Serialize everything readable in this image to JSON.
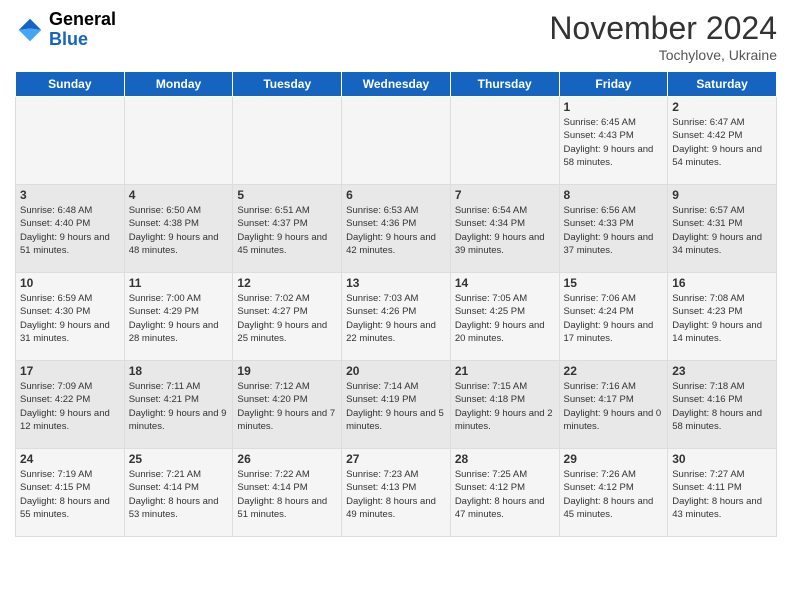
{
  "header": {
    "logo_general": "General",
    "logo_blue": "Blue",
    "month_title": "November 2024",
    "subtitle": "Tochylove, Ukraine"
  },
  "days_of_week": [
    "Sunday",
    "Monday",
    "Tuesday",
    "Wednesday",
    "Thursday",
    "Friday",
    "Saturday"
  ],
  "weeks": [
    [
      {
        "day": "",
        "info": ""
      },
      {
        "day": "",
        "info": ""
      },
      {
        "day": "",
        "info": ""
      },
      {
        "day": "",
        "info": ""
      },
      {
        "day": "",
        "info": ""
      },
      {
        "day": "1",
        "info": "Sunrise: 6:45 AM\nSunset: 4:43 PM\nDaylight: 9 hours and 58 minutes."
      },
      {
        "day": "2",
        "info": "Sunrise: 6:47 AM\nSunset: 4:42 PM\nDaylight: 9 hours and 54 minutes."
      }
    ],
    [
      {
        "day": "3",
        "info": "Sunrise: 6:48 AM\nSunset: 4:40 PM\nDaylight: 9 hours and 51 minutes."
      },
      {
        "day": "4",
        "info": "Sunrise: 6:50 AM\nSunset: 4:38 PM\nDaylight: 9 hours and 48 minutes."
      },
      {
        "day": "5",
        "info": "Sunrise: 6:51 AM\nSunset: 4:37 PM\nDaylight: 9 hours and 45 minutes."
      },
      {
        "day": "6",
        "info": "Sunrise: 6:53 AM\nSunset: 4:36 PM\nDaylight: 9 hours and 42 minutes."
      },
      {
        "day": "7",
        "info": "Sunrise: 6:54 AM\nSunset: 4:34 PM\nDaylight: 9 hours and 39 minutes."
      },
      {
        "day": "8",
        "info": "Sunrise: 6:56 AM\nSunset: 4:33 PM\nDaylight: 9 hours and 37 minutes."
      },
      {
        "day": "9",
        "info": "Sunrise: 6:57 AM\nSunset: 4:31 PM\nDaylight: 9 hours and 34 minutes."
      }
    ],
    [
      {
        "day": "10",
        "info": "Sunrise: 6:59 AM\nSunset: 4:30 PM\nDaylight: 9 hours and 31 minutes."
      },
      {
        "day": "11",
        "info": "Sunrise: 7:00 AM\nSunset: 4:29 PM\nDaylight: 9 hours and 28 minutes."
      },
      {
        "day": "12",
        "info": "Sunrise: 7:02 AM\nSunset: 4:27 PM\nDaylight: 9 hours and 25 minutes."
      },
      {
        "day": "13",
        "info": "Sunrise: 7:03 AM\nSunset: 4:26 PM\nDaylight: 9 hours and 22 minutes."
      },
      {
        "day": "14",
        "info": "Sunrise: 7:05 AM\nSunset: 4:25 PM\nDaylight: 9 hours and 20 minutes."
      },
      {
        "day": "15",
        "info": "Sunrise: 7:06 AM\nSunset: 4:24 PM\nDaylight: 9 hours and 17 minutes."
      },
      {
        "day": "16",
        "info": "Sunrise: 7:08 AM\nSunset: 4:23 PM\nDaylight: 9 hours and 14 minutes."
      }
    ],
    [
      {
        "day": "17",
        "info": "Sunrise: 7:09 AM\nSunset: 4:22 PM\nDaylight: 9 hours and 12 minutes."
      },
      {
        "day": "18",
        "info": "Sunrise: 7:11 AM\nSunset: 4:21 PM\nDaylight: 9 hours and 9 minutes."
      },
      {
        "day": "19",
        "info": "Sunrise: 7:12 AM\nSunset: 4:20 PM\nDaylight: 9 hours and 7 minutes."
      },
      {
        "day": "20",
        "info": "Sunrise: 7:14 AM\nSunset: 4:19 PM\nDaylight: 9 hours and 5 minutes."
      },
      {
        "day": "21",
        "info": "Sunrise: 7:15 AM\nSunset: 4:18 PM\nDaylight: 9 hours and 2 minutes."
      },
      {
        "day": "22",
        "info": "Sunrise: 7:16 AM\nSunset: 4:17 PM\nDaylight: 9 hours and 0 minutes."
      },
      {
        "day": "23",
        "info": "Sunrise: 7:18 AM\nSunset: 4:16 PM\nDaylight: 8 hours and 58 minutes."
      }
    ],
    [
      {
        "day": "24",
        "info": "Sunrise: 7:19 AM\nSunset: 4:15 PM\nDaylight: 8 hours and 55 minutes."
      },
      {
        "day": "25",
        "info": "Sunrise: 7:21 AM\nSunset: 4:14 PM\nDaylight: 8 hours and 53 minutes."
      },
      {
        "day": "26",
        "info": "Sunrise: 7:22 AM\nSunset: 4:14 PM\nDaylight: 8 hours and 51 minutes."
      },
      {
        "day": "27",
        "info": "Sunrise: 7:23 AM\nSunset: 4:13 PM\nDaylight: 8 hours and 49 minutes."
      },
      {
        "day": "28",
        "info": "Sunrise: 7:25 AM\nSunset: 4:12 PM\nDaylight: 8 hours and 47 minutes."
      },
      {
        "day": "29",
        "info": "Sunrise: 7:26 AM\nSunset: 4:12 PM\nDaylight: 8 hours and 45 minutes."
      },
      {
        "day": "30",
        "info": "Sunrise: 7:27 AM\nSunset: 4:11 PM\nDaylight: 8 hours and 43 minutes."
      }
    ]
  ]
}
